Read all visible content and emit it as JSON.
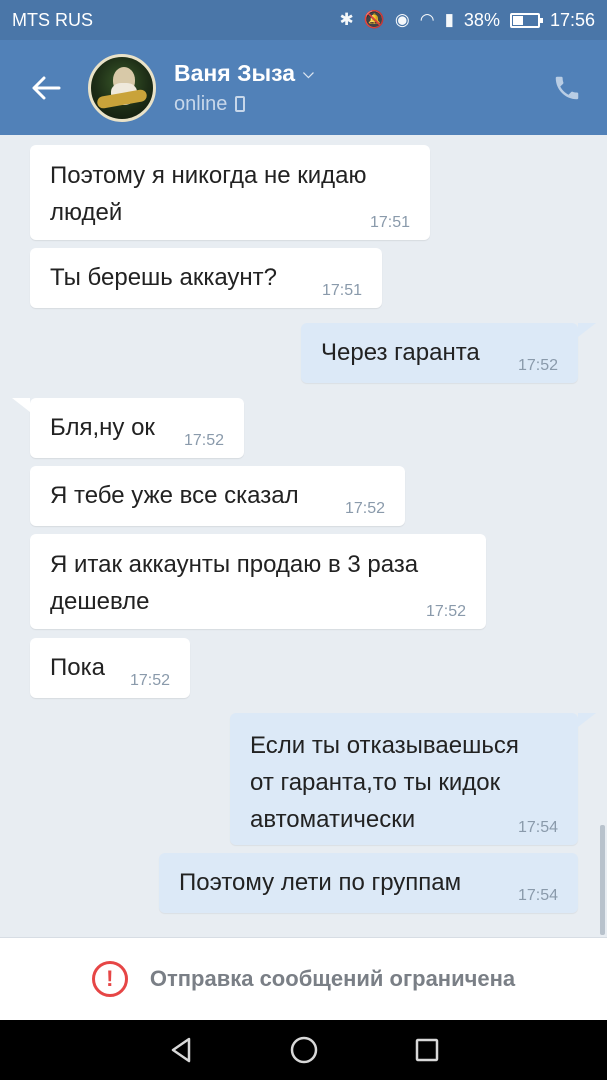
{
  "status_bar": {
    "carrier": "MTS RUS",
    "battery_text": "38%",
    "battery_level": 0.38,
    "time": "17:56",
    "icons": [
      "bluetooth-icon",
      "mute-icon",
      "eye-icon",
      "wifi-icon",
      "signal-icon",
      "battery-icon"
    ]
  },
  "header": {
    "contact_name": "Ваня Зыза",
    "status": "online",
    "accent": "#5181b8"
  },
  "messages": [
    {
      "dir": "in",
      "lines": [
        "Поэтому я никогда не кидаю",
        "людей"
      ],
      "time": "17:51"
    },
    {
      "dir": "in",
      "lines": [
        "Ты берешь аккаунт?"
      ],
      "time": "17:51"
    },
    {
      "dir": "out",
      "lines": [
        "Через гаранта"
      ],
      "time": "17:52"
    },
    {
      "dir": "in",
      "lines": [
        "Бля,ну ок"
      ],
      "time": "17:52"
    },
    {
      "dir": "in",
      "lines": [
        "Я тебе уже все сказал"
      ],
      "time": "17:52"
    },
    {
      "dir": "in",
      "lines": [
        "Я итак аккаунты продаю в 3 раза",
        "дешевле"
      ],
      "time": "17:52"
    },
    {
      "dir": "in",
      "lines": [
        "Пока"
      ],
      "time": "17:52"
    },
    {
      "dir": "out",
      "lines": [
        "Если ты отказываешься",
        "от гаранта,то ты кидок",
        "автоматически"
      ],
      "time": "17:54"
    },
    {
      "dir": "out",
      "lines": [
        "Поэтому лети по группам"
      ],
      "time": "17:54"
    }
  ],
  "restriction": {
    "text": "Отправка сообщений ограничена",
    "icon": "!",
    "color": "#e64646"
  }
}
